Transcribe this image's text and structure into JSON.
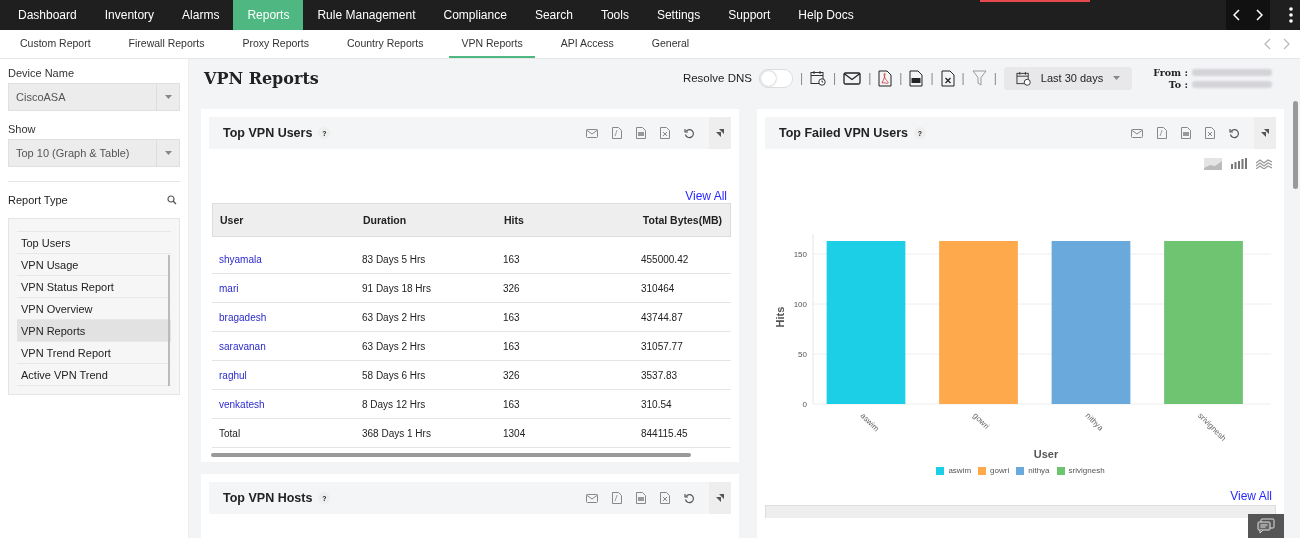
{
  "nav": {
    "items": [
      {
        "label": "Dashboard",
        "selected": false
      },
      {
        "label": "Inventory",
        "selected": false
      },
      {
        "label": "Alarms",
        "selected": false
      },
      {
        "label": "Reports",
        "selected": true
      },
      {
        "label": "Rule Management",
        "selected": false
      },
      {
        "label": "Compliance",
        "selected": false
      },
      {
        "label": "Search",
        "selected": false
      },
      {
        "label": "Tools",
        "selected": false
      },
      {
        "label": "Settings",
        "selected": false
      },
      {
        "label": "Support",
        "selected": false
      },
      {
        "label": "Help Docs",
        "selected": false
      }
    ]
  },
  "subnav": {
    "items": [
      {
        "label": "Custom Report",
        "selected": false
      },
      {
        "label": "Firewall Reports",
        "selected": false
      },
      {
        "label": "Proxy Reports",
        "selected": false
      },
      {
        "label": "Country Reports",
        "selected": false
      },
      {
        "label": "VPN Reports",
        "selected": true
      },
      {
        "label": "API Access",
        "selected": false
      },
      {
        "label": "General",
        "selected": false
      }
    ]
  },
  "sidebar": {
    "device_label": "Device Name",
    "device_value": "CiscoASA",
    "show_label": "Show",
    "show_value": "Top 10 (Graph & Table)",
    "report_type_label": "Report Type",
    "items": [
      {
        "label": "Top Users",
        "selected": false
      },
      {
        "label": "VPN Usage",
        "selected": false
      },
      {
        "label": "VPN Status Report",
        "selected": false
      },
      {
        "label": "VPN Overview",
        "selected": false
      },
      {
        "label": "VPN Reports",
        "selected": true
      },
      {
        "label": "VPN Trend Report",
        "selected": false
      },
      {
        "label": "Active VPN Trend",
        "selected": false
      }
    ]
  },
  "header": {
    "title": "VPN Reports",
    "resolve_dns": {
      "label": "Resolve DNS",
      "on": false
    },
    "separator": "|",
    "period": "Last 30 days",
    "from_label": "From :",
    "to_label": "To :"
  },
  "top_vpn_users": {
    "title": "Top VPN Users",
    "help": "?",
    "view_all": "View All",
    "columns": [
      "User",
      "Duration",
      "Hits",
      "Total Bytes(MB)"
    ],
    "rows": [
      [
        "shyamala",
        "83 Days 5 Hrs",
        "163",
        "455000.42"
      ],
      [
        "mari",
        "91 Days 18 Hrs",
        "326",
        "310464"
      ],
      [
        "bragadesh",
        "63 Days 2 Hrs",
        "163",
        "43744.87"
      ],
      [
        "saravanan",
        "63 Days 2 Hrs",
        "163",
        "31057.77"
      ],
      [
        "raghul",
        "58 Days 6 Hrs",
        "326",
        "3537.83"
      ],
      [
        "venkatesh",
        "8 Days 12 Hrs",
        "163",
        "310.54"
      ]
    ],
    "total": [
      "Total",
      "368 Days 1 Hrs",
      "1304",
      "844115.45"
    ]
  },
  "top_failed_vpn_users": {
    "title": "Top Failed VPN Users",
    "help": "?",
    "view_all": "View All",
    "chart_data": {
      "type": "bar",
      "xlabel": "User",
      "ylabel": "Hits",
      "categories": [
        "aswim",
        "gowri",
        "nithya",
        "srivignesh"
      ],
      "ylim": [
        0,
        170
      ],
      "yticks": [
        0,
        50,
        100,
        150
      ],
      "grid": true,
      "legend": "bottom",
      "series": [
        {
          "name": "aswim",
          "color": "#1ccfe6",
          "values": [
            163,
            null,
            null,
            null
          ]
        },
        {
          "name": "gowri",
          "color": "#ffa94d",
          "values": [
            null,
            163,
            null,
            null
          ]
        },
        {
          "name": "nithya",
          "color": "#6aa9dc",
          "values": [
            null,
            null,
            163,
            null
          ]
        },
        {
          "name": "srivignesh",
          "color": "#6fc472",
          "values": [
            null,
            null,
            null,
            163
          ]
        }
      ]
    }
  },
  "top_vpn_hosts": {
    "title": "Top VPN Hosts",
    "help": "?"
  }
}
